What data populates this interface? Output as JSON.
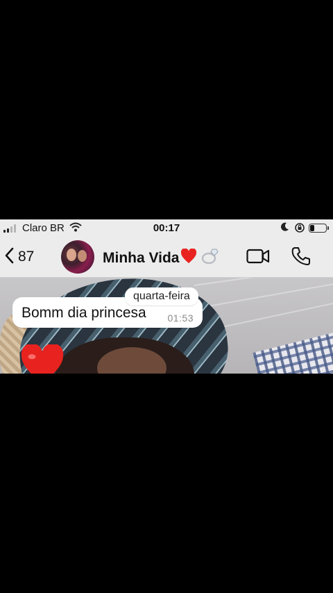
{
  "status_bar": {
    "carrier": "Claro BR",
    "time": "00:17",
    "battery_level_percent": 30,
    "icons": [
      "signal-icon",
      "wifi-icon",
      "moon-icon",
      "rotation-lock-icon",
      "battery-icon"
    ]
  },
  "header": {
    "back_count": "87",
    "contact_name": "Minha Vida",
    "name_emojis": [
      "heart-emoji",
      "ring-emoji"
    ],
    "actions": [
      "video-call-icon",
      "phone-call-icon"
    ]
  },
  "chat": {
    "date_label": "quarta-feira",
    "messages": [
      {
        "text": "Bomm dia princesa",
        "time": "01:53"
      }
    ],
    "reaction": "heart-emoji"
  },
  "colors": {
    "bars_bg": "#ececec",
    "bubble": "#ffffff",
    "heart": "#e8231f",
    "letterbox": "#000000"
  }
}
